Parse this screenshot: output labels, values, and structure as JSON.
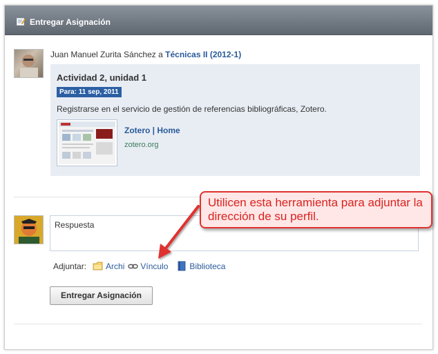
{
  "header": {
    "title": "Entregar Asignación",
    "icon": "edit-icon"
  },
  "post": {
    "author": "Juan Manuel Zurita Sánchez",
    "connector": "a",
    "course": "Técnicas II (2012-1)"
  },
  "activity": {
    "title": "Actividad 2, unidad 1",
    "due": "Para: 11 sep, 2011",
    "description": "Registrarse en el servicio de gestión de referencias bibliográficas, Zotero.",
    "link_title": "Zotero | Home",
    "link_url": "zotero.org"
  },
  "reply": {
    "placeholder": "Respuesta",
    "attach_label": "Adjuntar:",
    "attach_file": "Archi",
    "attach_link": "Vínculo",
    "attach_library": "Biblioteca",
    "submit_label": "Entregar Asignación"
  },
  "annotation": {
    "text": "Utilicen esta herramienta para adjuntar la dirección de su perfil."
  },
  "colors": {
    "header": "#6b737c",
    "link": "#2a5a9a",
    "badge": "#2b5fa3",
    "callout_border": "#e0312f",
    "callout_text": "#d9231f"
  }
}
